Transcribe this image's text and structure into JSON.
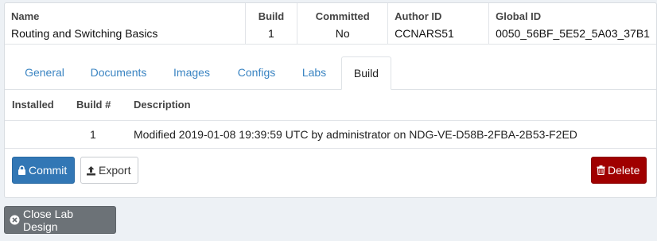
{
  "summary": {
    "headers": {
      "name": "Name",
      "build": "Build",
      "committed": "Committed",
      "author_id": "Author ID",
      "global_id": "Global ID"
    },
    "values": {
      "name": "Routing and Switching Basics",
      "build": "1",
      "committed": "No",
      "author_id": "CCNARS51",
      "global_id": "0050_56BF_5E52_5A03_37B1"
    }
  },
  "tabs": [
    {
      "label": "General",
      "active": false
    },
    {
      "label": "Documents",
      "active": false
    },
    {
      "label": "Images",
      "active": false
    },
    {
      "label": "Configs",
      "active": false
    },
    {
      "label": "Labs",
      "active": false
    },
    {
      "label": "Build",
      "active": true
    }
  ],
  "build_table": {
    "headers": {
      "installed": "Installed",
      "build_num": "Build #",
      "description": "Description"
    },
    "rows": [
      {
        "installed": "",
        "build_num": "1",
        "description": "Modified 2019-01-08 19:39:59 UTC by administrator on NDG-VE-D58B-2FBA-2B53-F2ED"
      }
    ]
  },
  "buttons": {
    "commit": {
      "label": "Commit",
      "icon": "lock-icon",
      "color": "#3277b5"
    },
    "export": {
      "label": "Export",
      "icon": "upload-icon"
    },
    "delete": {
      "label": "Delete",
      "icon": "trash-icon",
      "color": "#a00000"
    },
    "close": {
      "label": "Close Lab Design",
      "icon": "close-circle-icon",
      "color": "#6c7277"
    }
  },
  "colors": {
    "page_background": "#edf1f5",
    "tab_link": "#3a84c2"
  }
}
